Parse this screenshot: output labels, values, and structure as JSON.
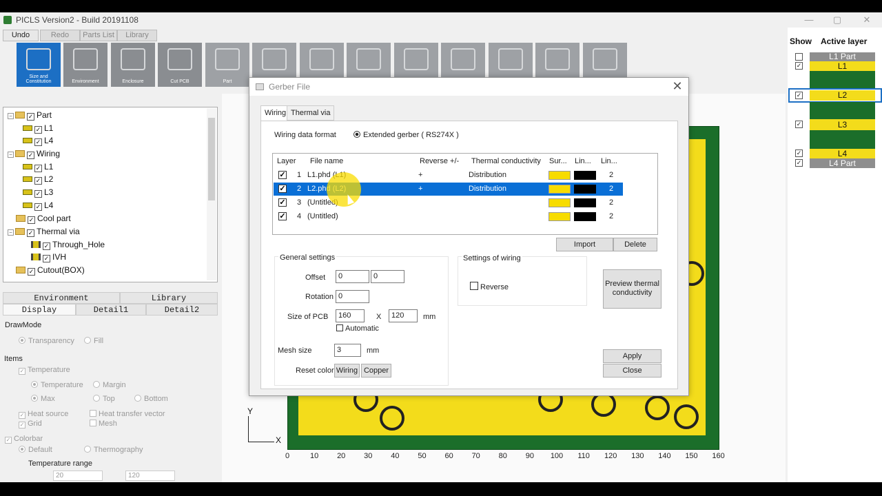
{
  "window": {
    "title": "PICLS Version2 - Build 20191108",
    "minimize": "—",
    "maximize": "▢",
    "close": "✕"
  },
  "toolbar": {
    "tabs": [
      "Undo",
      "Redo",
      "Parts List",
      "Library"
    ],
    "tools": [
      {
        "label": "Size and Constitution",
        "icon": "size-constitution-icon"
      },
      {
        "label": "Environment",
        "icon": "environment-icon"
      },
      {
        "label": "Enclosure",
        "icon": "enclosure-icon"
      },
      {
        "label": "Cut PCB",
        "icon": "scissors-icon"
      },
      {
        "label": "Part",
        "icon": "chip-icon"
      },
      {
        "label": "",
        "icon": "heatsink-icon"
      },
      {
        "label": "",
        "icon": "wiring-icon"
      },
      {
        "label": "",
        "icon": "thermal-via-icon"
      },
      {
        "label": "",
        "icon": "magnifier-icon"
      },
      {
        "label": "",
        "icon": "monitor-icon"
      },
      {
        "label": "",
        "icon": "printer-icon"
      },
      {
        "label": "",
        "icon": "3d-box-icon"
      },
      {
        "label": "",
        "icon": "book-icon"
      }
    ]
  },
  "tree": {
    "part": "Part",
    "p_l1": "L1",
    "p_l4": "L4",
    "wiring": "Wiring",
    "w_l1": "L1",
    "w_l2": "L2",
    "w_l3": "L3",
    "w_l4": "L4",
    "cool": "Cool part",
    "thermal": "Thermal via",
    "through": "Through_Hole",
    "ivh": "IVH",
    "cutout": "Cutout(BOX)"
  },
  "panel_tabs": {
    "environment": "Environment",
    "library": "Library",
    "display": "Display",
    "detail1": "Detail1",
    "detail2": "Detail2"
  },
  "display": {
    "drawmode": "DrawMode",
    "transparency": "Transparency",
    "fill": "Fill",
    "items": "Items",
    "temperature_chk": "Temperature",
    "temperature_rad": "Temperature",
    "margin": "Margin",
    "max": "Max",
    "top": "Top",
    "bottom": "Bottom",
    "heat_source": "Heat source",
    "heat_transfer": "Heat transfer vector",
    "grid": "Grid",
    "mesh": "Mesh",
    "colorbar": "Colorbar",
    "default": "Default",
    "thermography": "Thermography",
    "temp_range": "Temperature range",
    "range_min": "20",
    "range_max": "120"
  },
  "canvas": {
    "y_label": "Y",
    "x_label": "X",
    "x_ticks": [
      "0",
      "10",
      "20",
      "30",
      "40",
      "50",
      "60",
      "70",
      "80",
      "90",
      "100",
      "110",
      "120",
      "130",
      "140",
      "150",
      "160"
    ]
  },
  "layers": {
    "show": "Show",
    "active": "Active layer",
    "items": [
      {
        "label": "L1 Part",
        "checked": false
      },
      {
        "label": "L1",
        "checked": true
      },
      {
        "label": "L2",
        "checked": true
      },
      {
        "label": "L3",
        "checked": true
      },
      {
        "label": "L4",
        "checked": true
      },
      {
        "label": "L4 Part",
        "checked": true
      }
    ]
  },
  "dialog": {
    "title": "Gerber File",
    "tabs": [
      "Wiring",
      "Thermal via"
    ],
    "format_label": "Wiring data format",
    "format_option": "Extended gerber ( RS274X )",
    "columns": [
      "Layer",
      "File name",
      "Reverse +/-",
      "Thermal conductivity",
      "Sur...",
      "Lin...",
      "Lin..."
    ],
    "rows": [
      {
        "n": "1",
        "file": "L1.phd (L1)",
        "rev": "+",
        "thermal": "Distribution",
        "lin": "2",
        "selected": false
      },
      {
        "n": "2",
        "file": "L2.phd (L2)",
        "rev": "+",
        "thermal": "Distribution",
        "lin": "2",
        "selected": true
      },
      {
        "n": "3",
        "file": "(Untitled)",
        "rev": "",
        "thermal": "",
        "lin": "2",
        "selected": false
      },
      {
        "n": "4",
        "file": "(Untitled)",
        "rev": "",
        "thermal": "",
        "lin": "2",
        "selected": false
      }
    ],
    "import": "Import",
    "delete": "Delete",
    "general": "General settings",
    "offset_label": "Offset",
    "offset_x": "0",
    "offset_y": "0",
    "rotation_label": "Rotation",
    "rotation": "0",
    "size_label": "Size of PCB",
    "size_x": "160",
    "size_sep": "X",
    "size_y": "120",
    "size_unit": "mm",
    "automatic": "Automatic",
    "mesh_label": "Mesh size",
    "mesh": "3",
    "mesh_unit": "mm",
    "reset_label": "Reset color",
    "reset_wiring": "Wiring",
    "reset_copper": "Copper",
    "settings_wiring": "Settings of wiring",
    "reverse": "Reverse",
    "preview": "Preview thermal conductivity",
    "apply": "Apply",
    "close": "Close"
  }
}
